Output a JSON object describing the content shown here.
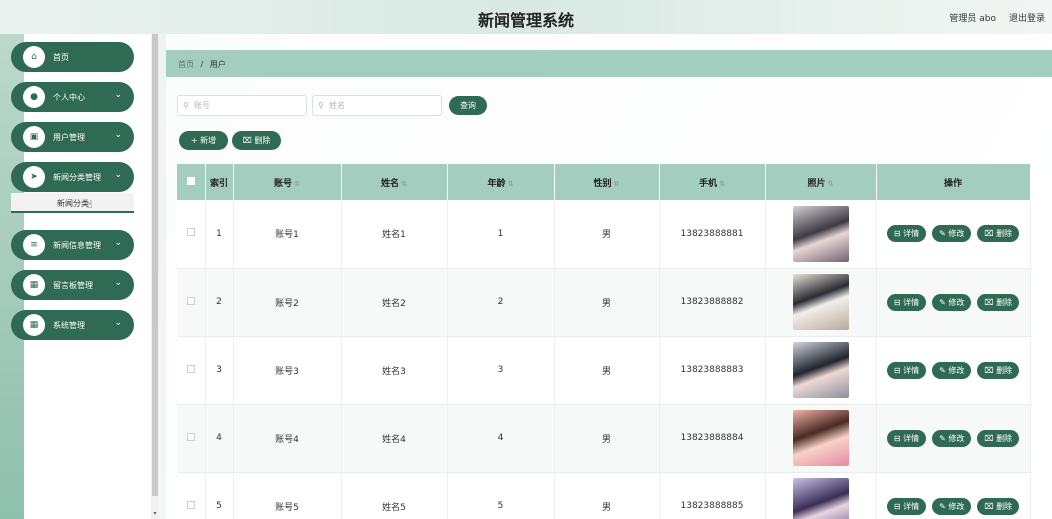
{
  "header": {
    "title": "新闻管理系统",
    "admin": "管理员 abo",
    "logout": "退出登录"
  },
  "sidebar": {
    "items": [
      {
        "label": "首页",
        "icon": "home-icon",
        "glyph": "⌂",
        "arrow": ""
      },
      {
        "label": "个人中心",
        "icon": "user-icon",
        "glyph": "●",
        "arrow": "⌄"
      },
      {
        "label": "用户管理",
        "icon": "id-card-icon",
        "glyph": "▣",
        "arrow": "⌄"
      },
      {
        "label": "新闻分类管理",
        "icon": "send-icon",
        "glyph": "➤",
        "arrow": "⌄"
      },
      {
        "label": "新闻信息管理",
        "icon": "list-icon",
        "glyph": "≡",
        "arrow": "⌄"
      },
      {
        "label": "留言板管理",
        "icon": "grid-icon",
        "glyph": "▦",
        "arrow": "⌄"
      },
      {
        "label": "系统管理",
        "icon": "grid-icon",
        "glyph": "▦",
        "arrow": "⌄"
      }
    ],
    "submenu_label": "新闻分类"
  },
  "breadcrumb": {
    "home": "首页",
    "separator": "/",
    "current": "用户"
  },
  "search": {
    "account_placeholder": "账号",
    "name_placeholder": "姓名",
    "query_label": "查询"
  },
  "toolbar": {
    "add_label": "+ 新增",
    "delete_label": "⌧ 删除"
  },
  "table": {
    "headers": {
      "index": "索引",
      "account": "账号",
      "name": "姓名",
      "age": "年龄",
      "gender": "性别",
      "phone": "手机",
      "photo": "照片",
      "actions": "操作"
    },
    "rows": [
      {
        "index": "1",
        "account": "账号1",
        "name": "姓名1",
        "age": "1",
        "gender": "男",
        "phone": "13823888881"
      },
      {
        "index": "2",
        "account": "账号2",
        "name": "姓名2",
        "age": "2",
        "gender": "男",
        "phone": "13823888882"
      },
      {
        "index": "3",
        "account": "账号3",
        "name": "姓名3",
        "age": "3",
        "gender": "男",
        "phone": "13823888883"
      },
      {
        "index": "4",
        "account": "账号4",
        "name": "姓名4",
        "age": "4",
        "gender": "男",
        "phone": "13823888884"
      },
      {
        "index": "5",
        "account": "账号5",
        "name": "姓名5",
        "age": "5",
        "gender": "男",
        "phone": "13823888885"
      }
    ],
    "actions": {
      "detail": "⊟ 详情",
      "edit": "✎ 修改",
      "delete": "⌧ 删除"
    }
  },
  "colors": {
    "accent": "#2f6a54",
    "header_bg": "#a3cdbf"
  }
}
